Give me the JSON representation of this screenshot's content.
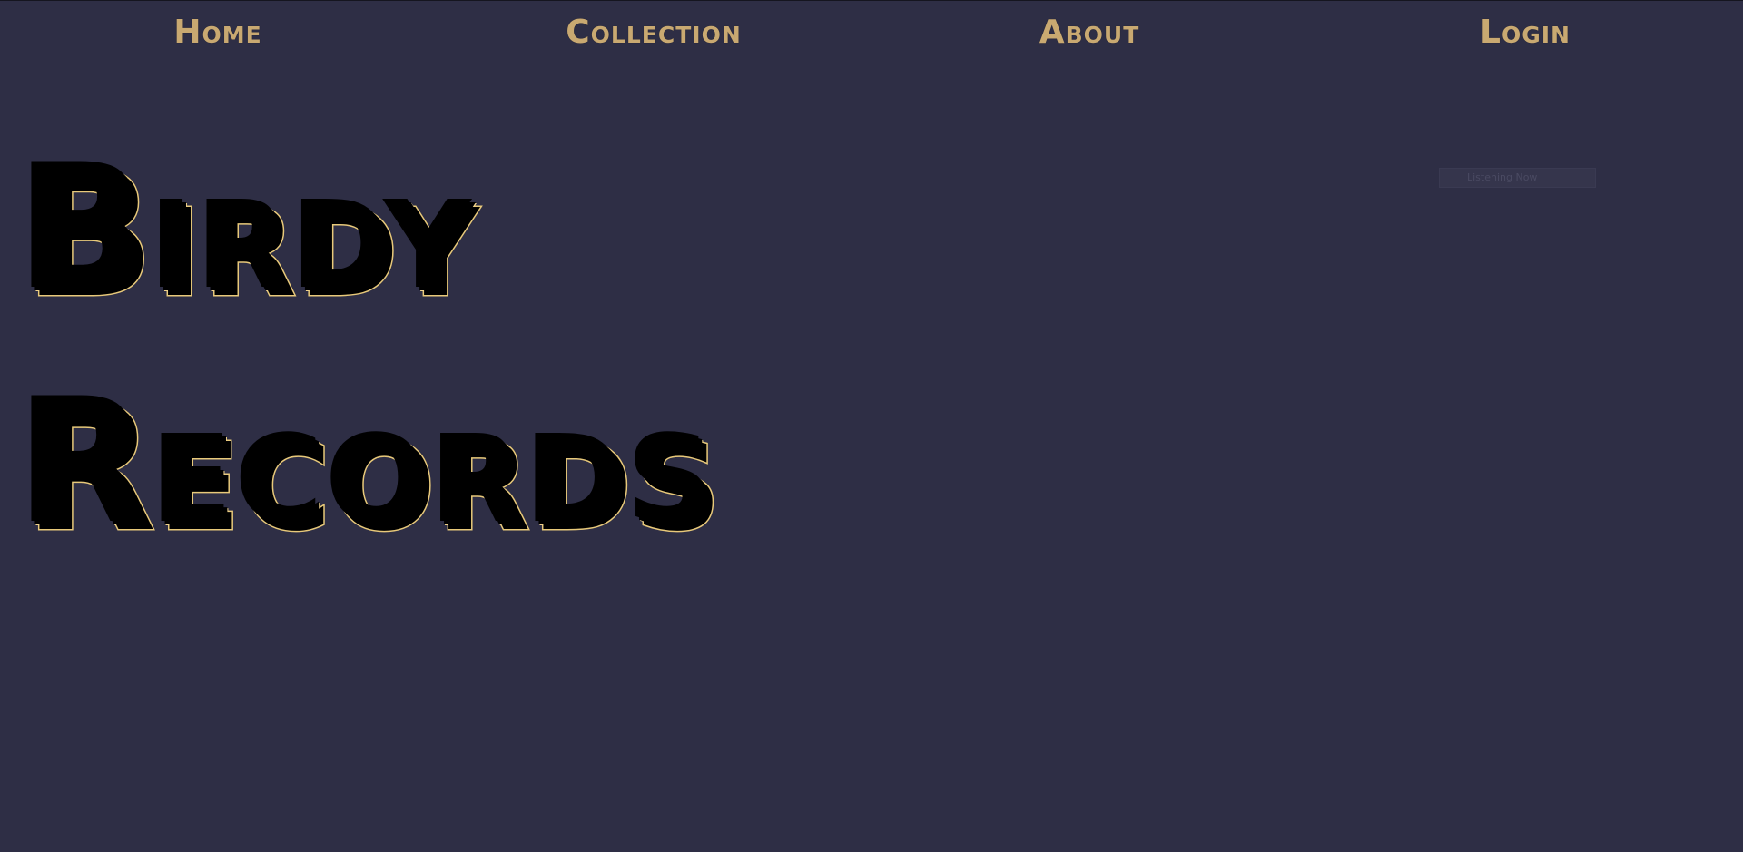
{
  "nav": {
    "items": [
      {
        "label": "Home"
      },
      {
        "label": "Collection"
      },
      {
        "label": "About"
      },
      {
        "label": "Login"
      }
    ]
  },
  "hero": {
    "line1": "Birdy",
    "line2": "Records"
  },
  "widget": {
    "label": "Listening Now"
  },
  "colors": {
    "background": "#2e2e45",
    "accent_gold": "#c9a971",
    "title_outline": "#e8c97a"
  }
}
